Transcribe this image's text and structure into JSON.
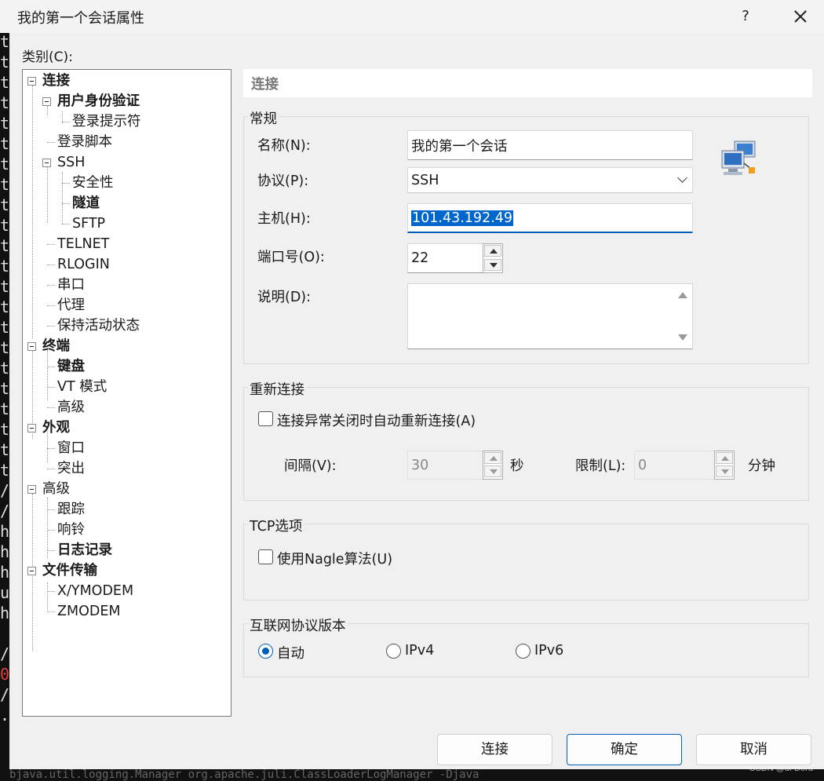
{
  "window": {
    "title": "我的第一个会话属性",
    "help": "?",
    "close_icon": "close-icon"
  },
  "category_label": "类别(C):",
  "tree": [
    {
      "label": "连接",
      "bold": true
    },
    {
      "label": "用户身份验证",
      "bold": true
    },
    {
      "label": "登录提示符",
      "bold": false
    },
    {
      "label": "登录脚本",
      "bold": false
    },
    {
      "label": "SSH",
      "bold": false
    },
    {
      "label": "安全性",
      "bold": false
    },
    {
      "label": "隧道",
      "bold": true
    },
    {
      "label": "SFTP",
      "bold": false
    },
    {
      "label": "TELNET",
      "bold": false
    },
    {
      "label": "RLOGIN",
      "bold": false
    },
    {
      "label": "串口",
      "bold": false
    },
    {
      "label": "代理",
      "bold": false
    },
    {
      "label": "保持活动状态",
      "bold": false
    },
    {
      "label": "终端",
      "bold": true
    },
    {
      "label": "键盘",
      "bold": true
    },
    {
      "label": "VT 模式",
      "bold": false
    },
    {
      "label": "高级",
      "bold": false
    },
    {
      "label": "外观",
      "bold": true
    },
    {
      "label": "窗口",
      "bold": false
    },
    {
      "label": "突出",
      "bold": false
    },
    {
      "label": "高级",
      "bold": false
    },
    {
      "label": "跟踪",
      "bold": false
    },
    {
      "label": "响铃",
      "bold": false
    },
    {
      "label": "日志记录",
      "bold": true
    },
    {
      "label": "文件传输",
      "bold": true
    },
    {
      "label": "X/YMODEM",
      "bold": false
    },
    {
      "label": "ZMODEM",
      "bold": false
    }
  ],
  "section_title": "连接",
  "general": {
    "title": "常规",
    "name_label": "名称(N):",
    "name_value": "我的第一个会话",
    "protocol_label": "协议(P):",
    "protocol_value": "SSH",
    "host_label": "主机(H):",
    "host_value": "101.43.192.49",
    "port_label": "端口号(O):",
    "port_value": "22",
    "desc_label": "说明(D):",
    "desc_value": ""
  },
  "reconnect": {
    "title": "重新连接",
    "checkbox_label": "连接异常关闭时自动重新连接(A)",
    "checked": false,
    "interval_label": "间隔(V):",
    "interval_value": "30",
    "interval_unit": "秒",
    "limit_label": "限制(L):",
    "limit_value": "0",
    "limit_unit": "分钟"
  },
  "tcp": {
    "title": "TCP选项",
    "nagle_label": "使用Nagle算法(U)",
    "checked": false
  },
  "ipver": {
    "title": "互联网协议版本",
    "options": [
      "自动",
      "IPv4",
      "IPv6"
    ],
    "selected": "自动"
  },
  "buttons": {
    "connect": "连接",
    "ok": "确定",
    "cancel": "取消"
  },
  "background": {
    "left_chars": [
      "t",
      "t",
      "t",
      "t",
      "t",
      "t",
      "t",
      "t",
      "t",
      "t",
      "t",
      "t",
      "t",
      "t",
      "t",
      "t",
      "t",
      "t",
      "t",
      "t",
      "t",
      "t",
      "/",
      "/",
      "h",
      "h",
      "h",
      "u",
      "h",
      "",
      "/",
      "0",
      "/",
      "."
    ],
    "bottom_text": "bjava.util.logging.Manager org.apache.juli.ClassLoaderLogManager -Djava",
    "watermark": "CSDN @di-Dora"
  }
}
